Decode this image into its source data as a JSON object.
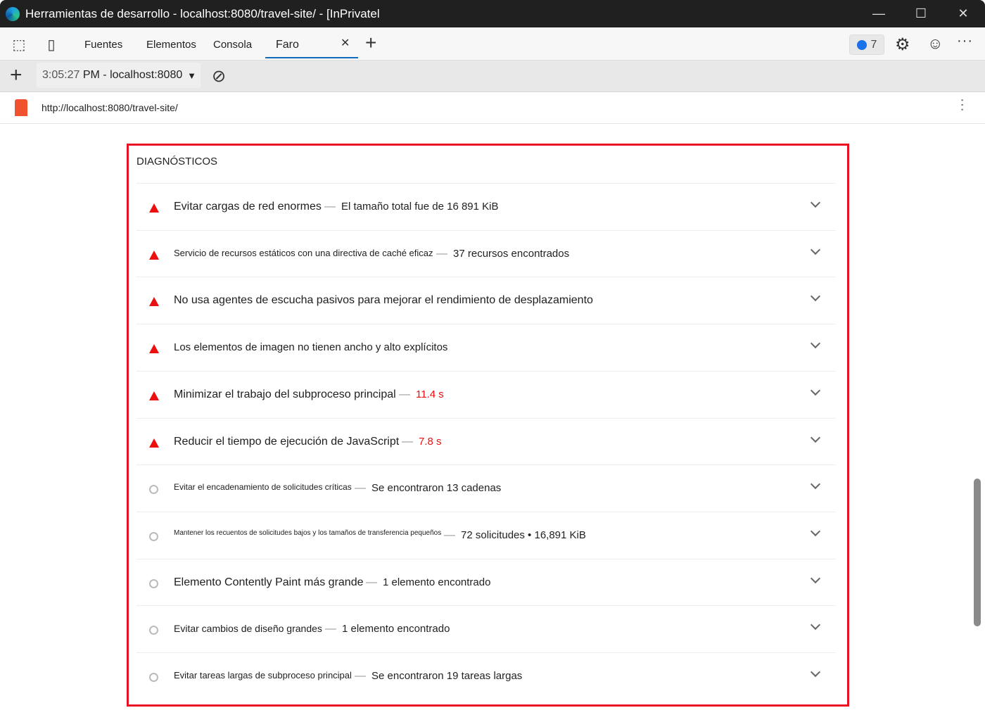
{
  "window": {
    "title": "Herramientas de desarrollo - localhost:8080/travel-site/ - [InPrivatel"
  },
  "tabs": [
    {
      "label": "Fuentes"
    },
    {
      "label": "Elementos"
    },
    {
      "label": "Consola"
    },
    {
      "label": "Faro",
      "active": true
    }
  ],
  "issues_badge": {
    "count": "7"
  },
  "toolbar": {
    "time": "3:05:27",
    "report": "PM - localhost:8080"
  },
  "urlbar": {
    "url": "http://localhost:8080/travel-site/"
  },
  "section": {
    "title": "DIAGNÓSTICOS"
  },
  "colors": {
    "fail": "#eb0f0f",
    "highlight": "#e81123",
    "accent": "#0f6cbd"
  },
  "audits": [
    {
      "status": "fail",
      "title": "Evitar cargas de red enormes",
      "detail": "El tamaño total fue de 16 891 KiB"
    },
    {
      "status": "fail",
      "title": "Servicio de recursos estáticos con una directiva de caché eficaz",
      "detail": "37 recursos encontrados"
    },
    {
      "status": "fail",
      "title": "No usa agentes de escucha pasivos para mejorar el rendimiento de desplazamiento",
      "detail": ""
    },
    {
      "status": "fail",
      "title": "Los elementos de imagen no tienen ancho y alto explícitos",
      "detail": ""
    },
    {
      "status": "fail",
      "title": "Minimizar el trabajo del subproceso principal",
      "detail": "11.4 s"
    },
    {
      "status": "fail",
      "title": "Reducir el tiempo de ejecución de JavaScript",
      "detail": "7.8 s"
    },
    {
      "status": "info",
      "title": "Evitar el encadenamiento de solicitudes críticas",
      "detail": "Se encontraron 13 cadenas"
    },
    {
      "status": "info",
      "title": "Mantener los recuentos de solicitudes bajos y los tamaños de transferencia pequeños",
      "detail": "72 solicitudes • 16,891 KiB"
    },
    {
      "status": "info",
      "title": "Elemento Contently Paint más grande",
      "detail": "1 elemento encontrado"
    },
    {
      "status": "info",
      "title": "Evitar cambios de diseño grandes",
      "detail": "1 elemento encontrado"
    },
    {
      "status": "info",
      "title": "Evitar tareas largas de subproceso principal",
      "detail": "Se encontraron 19 tareas largas"
    }
  ]
}
